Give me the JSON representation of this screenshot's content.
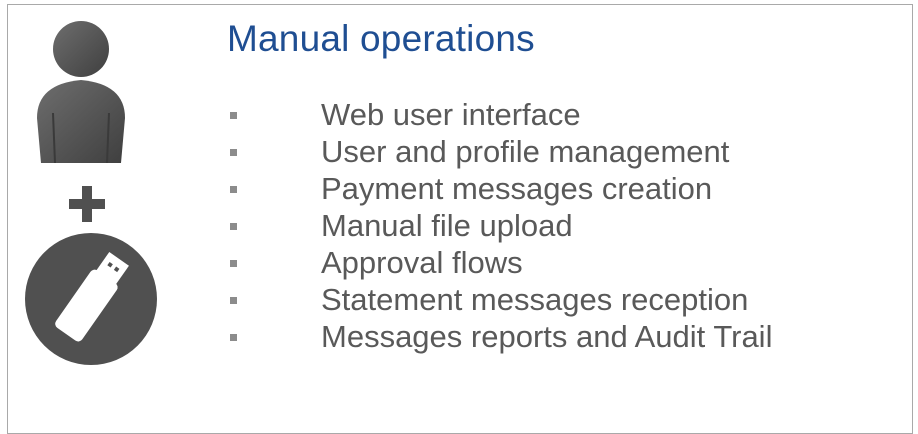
{
  "title": "Manual operations",
  "features": [
    "Web user interface",
    "User and profile management",
    "Payment messages creation",
    "Manual file upload",
    "Approval flows",
    "Statement messages reception",
    "Messages reports and Audit Trail"
  ],
  "icons": {
    "person": "person-icon",
    "plus": "plus-icon",
    "usb": "usb-drive-icon"
  },
  "colors": {
    "title": "#1f4e92",
    "text": "#595959",
    "bullet": "#8c8c8c",
    "icon": "#505050",
    "border": "#a9a9a9"
  }
}
